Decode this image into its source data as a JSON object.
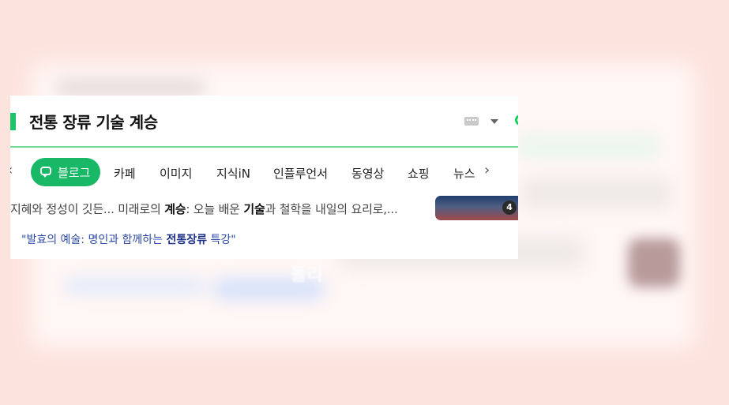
{
  "background": {
    "blurred_text": "돌리"
  },
  "search": {
    "query": "전통 장류 기술 계승"
  },
  "icons": {
    "keyboard": "keyboard-icon",
    "dropdown": "chevron-down-icon",
    "green_circle": "green-circle-icon",
    "prev": "chevron-left-icon",
    "next": "chevron-right-icon",
    "blog": "blog-speech-icon"
  },
  "tabs": {
    "prev_glyph": "‹",
    "active_label": "블로그",
    "items": [
      "카페",
      "이미지",
      "지식iN",
      "인플루언서",
      "동영상",
      "쇼핑",
      "뉴스"
    ],
    "next_glyph": "›"
  },
  "result": {
    "snippet_parts": [
      "지혜와 정성이 깃든... 미래로의 ",
      "계승",
      ": 오늘 배운 ",
      "기술",
      "과 철학을 내일의 요리로,..."
    ],
    "thumbnail_badge": "4"
  },
  "suggestion": {
    "parts": [
      "\"발효의 예술: 명인과 함께하는 ",
      "전통장류",
      " 특강\""
    ]
  },
  "colors": {
    "accent_green": "#19b866",
    "underline_green": "#6fdc93",
    "link_blue": "#2c4aa6",
    "backdrop": "#fde3de"
  }
}
